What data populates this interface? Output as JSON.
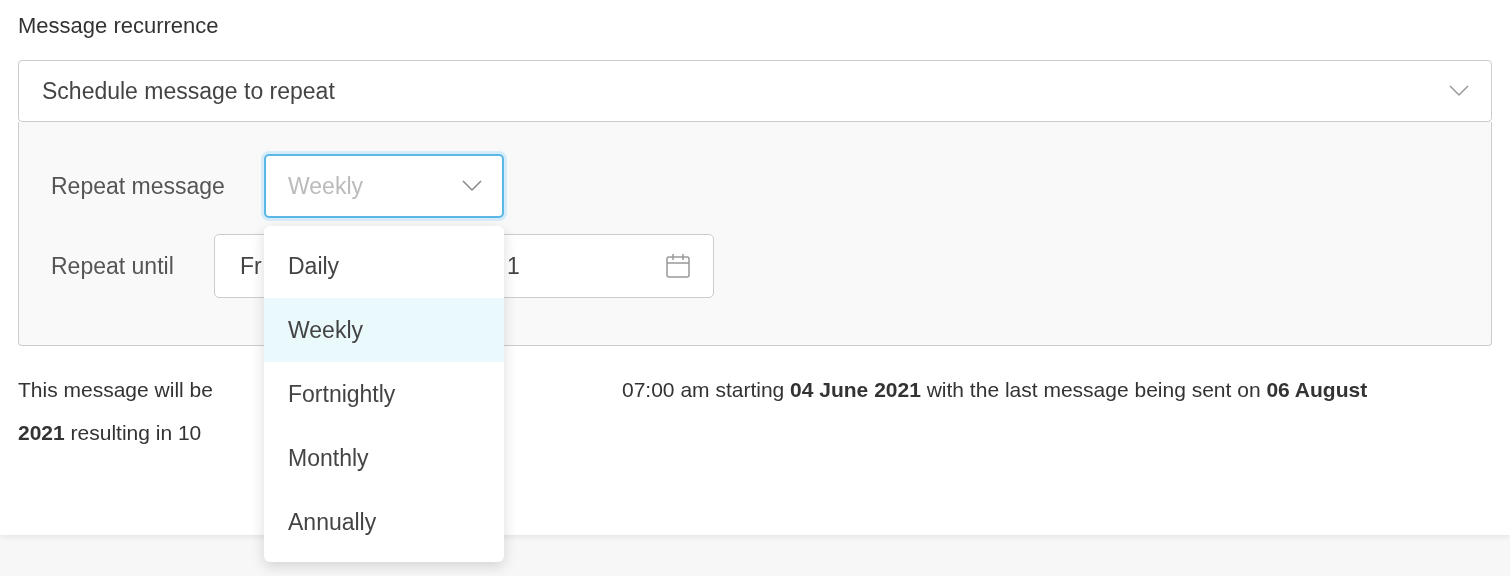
{
  "label": "Message recurrence",
  "recurrence_select": {
    "value": "Schedule message to repeat"
  },
  "repeat_message": {
    "label": "Repeat message",
    "placeholder": "Weekly"
  },
  "repeat_until": {
    "label": "Repeat until",
    "value_parts": [
      "Fr",
      "1"
    ]
  },
  "dropdown": {
    "options": [
      {
        "label": "Daily",
        "selected": false
      },
      {
        "label": "Weekly",
        "selected": true
      },
      {
        "label": "Fortnightly",
        "selected": false
      },
      {
        "label": "Monthly",
        "selected": false
      },
      {
        "label": "Annually",
        "selected": false
      }
    ]
  },
  "summary": {
    "lines": [
      [
        "This message will be",
        "07:00 am starting **04 June 2021** with the last message being sent on **06 August**"
      ],
      [
        "**2021** resulting in 10"
      ]
    ]
  }
}
